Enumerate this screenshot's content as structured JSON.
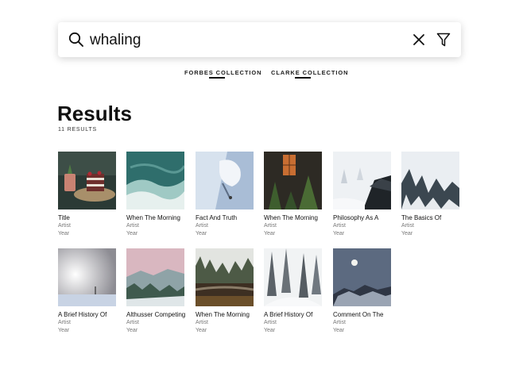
{
  "search": {
    "value": "whaling",
    "icon": "search-icon",
    "clear_icon": "close-icon",
    "filter_icon": "filter-icon"
  },
  "tabs": [
    {
      "label_plain": "FORBES ",
      "label_underlined": "COLLECTION"
    },
    {
      "label_plain": "CLARKE ",
      "label_underlined": "COLLECTION"
    }
  ],
  "results": {
    "title": "Results",
    "count": "11 RESULTS",
    "items": [
      {
        "title": "Title",
        "artist": "Artist",
        "year": "Year"
      },
      {
        "title": "When The Morning",
        "artist": "Artist",
        "year": "Year"
      },
      {
        "title": "Fact And Truth",
        "artist": "Artist",
        "year": "Year"
      },
      {
        "title": "When The Morning",
        "artist": "Artist",
        "year": "Year"
      },
      {
        "title": "Philosophy As A",
        "artist": "Artist",
        "year": "Year"
      },
      {
        "title": "The Basics Of",
        "artist": "Artist",
        "year": "Year"
      },
      {
        "title": "A Brief History Of",
        "artist": "Artist",
        "year": "Year"
      },
      {
        "title": "Althusser Competing",
        "artist": "Artist",
        "year": "Year"
      },
      {
        "title": "When The Morning",
        "artist": "Artist",
        "year": "Year"
      },
      {
        "title": "A Brief History Of",
        "artist": "Artist",
        "year": "Year"
      },
      {
        "title": "Comment On The",
        "artist": "Artist",
        "year": "Year"
      }
    ]
  },
  "colors": {
    "text": "#111111",
    "meta_text": "#777777",
    "search_shadow": "#d0d0d0"
  }
}
